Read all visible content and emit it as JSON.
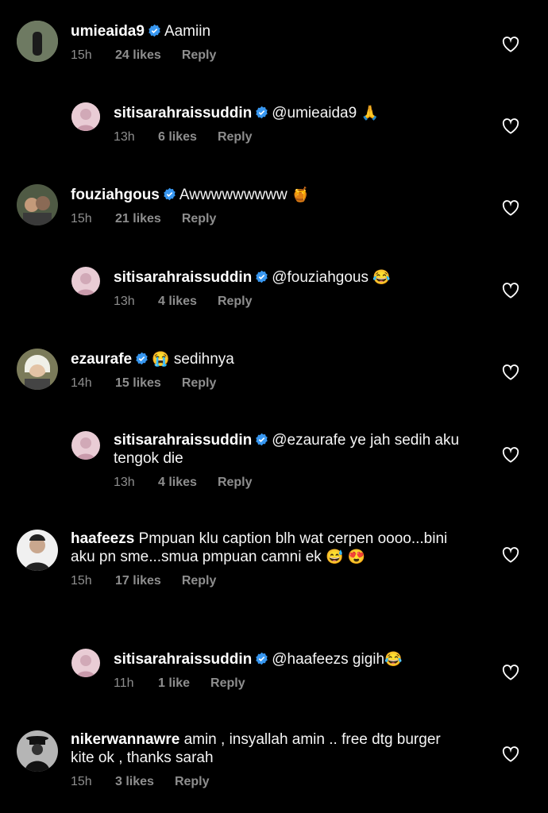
{
  "comments": [
    {
      "username": "umieaida9",
      "text": "Aamiin",
      "emoji": "",
      "time": "15h",
      "likes": "24 likes",
      "reply": "Reply",
      "avatar_color": "#6b7a5e"
    },
    {
      "username": "sitisarahraissuddin",
      "text": "@umieaida9",
      "emoji": "🙏",
      "time": "13h",
      "likes": "6 likes",
      "reply": "Reply",
      "avatar_color": "#d6b3c0"
    },
    {
      "username": "fouziahgous",
      "text": "Awwwwwwwww",
      "emoji": "🍯",
      "time": "15h",
      "likes": "21 likes",
      "reply": "Reply",
      "avatar_color": "#7a6a5a"
    },
    {
      "username": "sitisarahraissuddin",
      "text": "@fouziahgous",
      "emoji": "😂",
      "time": "13h",
      "likes": "4 likes",
      "reply": "Reply",
      "avatar_color": "#d6b3c0"
    },
    {
      "username": "ezaurafe",
      "text": "sedihnya",
      "emoji": "😭",
      "time": "14h",
      "likes": "15 likes",
      "reply": "Reply",
      "avatar_color": "#8a8a6a"
    },
    {
      "username": "sitisarahraissuddin",
      "text": "@ezaurafe ye jah sedih aku tengok die",
      "emoji": "",
      "time": "13h",
      "likes": "4 likes",
      "reply": "Reply",
      "avatar_color": "#d6b3c0"
    },
    {
      "username": "haafeezs",
      "text": "Pmpuan klu caption blh wat cerpen oooo...bini aku pn sme...smua pmpuan camni ek",
      "emoji": "😅 😍",
      "time": "15h",
      "likes": "17 likes",
      "reply": "Reply",
      "avatar_color": "#dcdcdc"
    },
    {
      "username": "sitisarahraissuddin",
      "text": "@haafeezs gigih",
      "emoji": "😂",
      "time": "11h",
      "likes": "1 like",
      "reply": "Reply",
      "avatar_color": "#d6b3c0"
    },
    {
      "username": "nikerwannawre",
      "text": "amin , insyallah amin .. free dtg burger kite ok , thanks sarah",
      "emoji": "",
      "time": "15h",
      "likes": "3 likes",
      "reply": "Reply",
      "avatar_color": "#aaaaaa"
    }
  ]
}
